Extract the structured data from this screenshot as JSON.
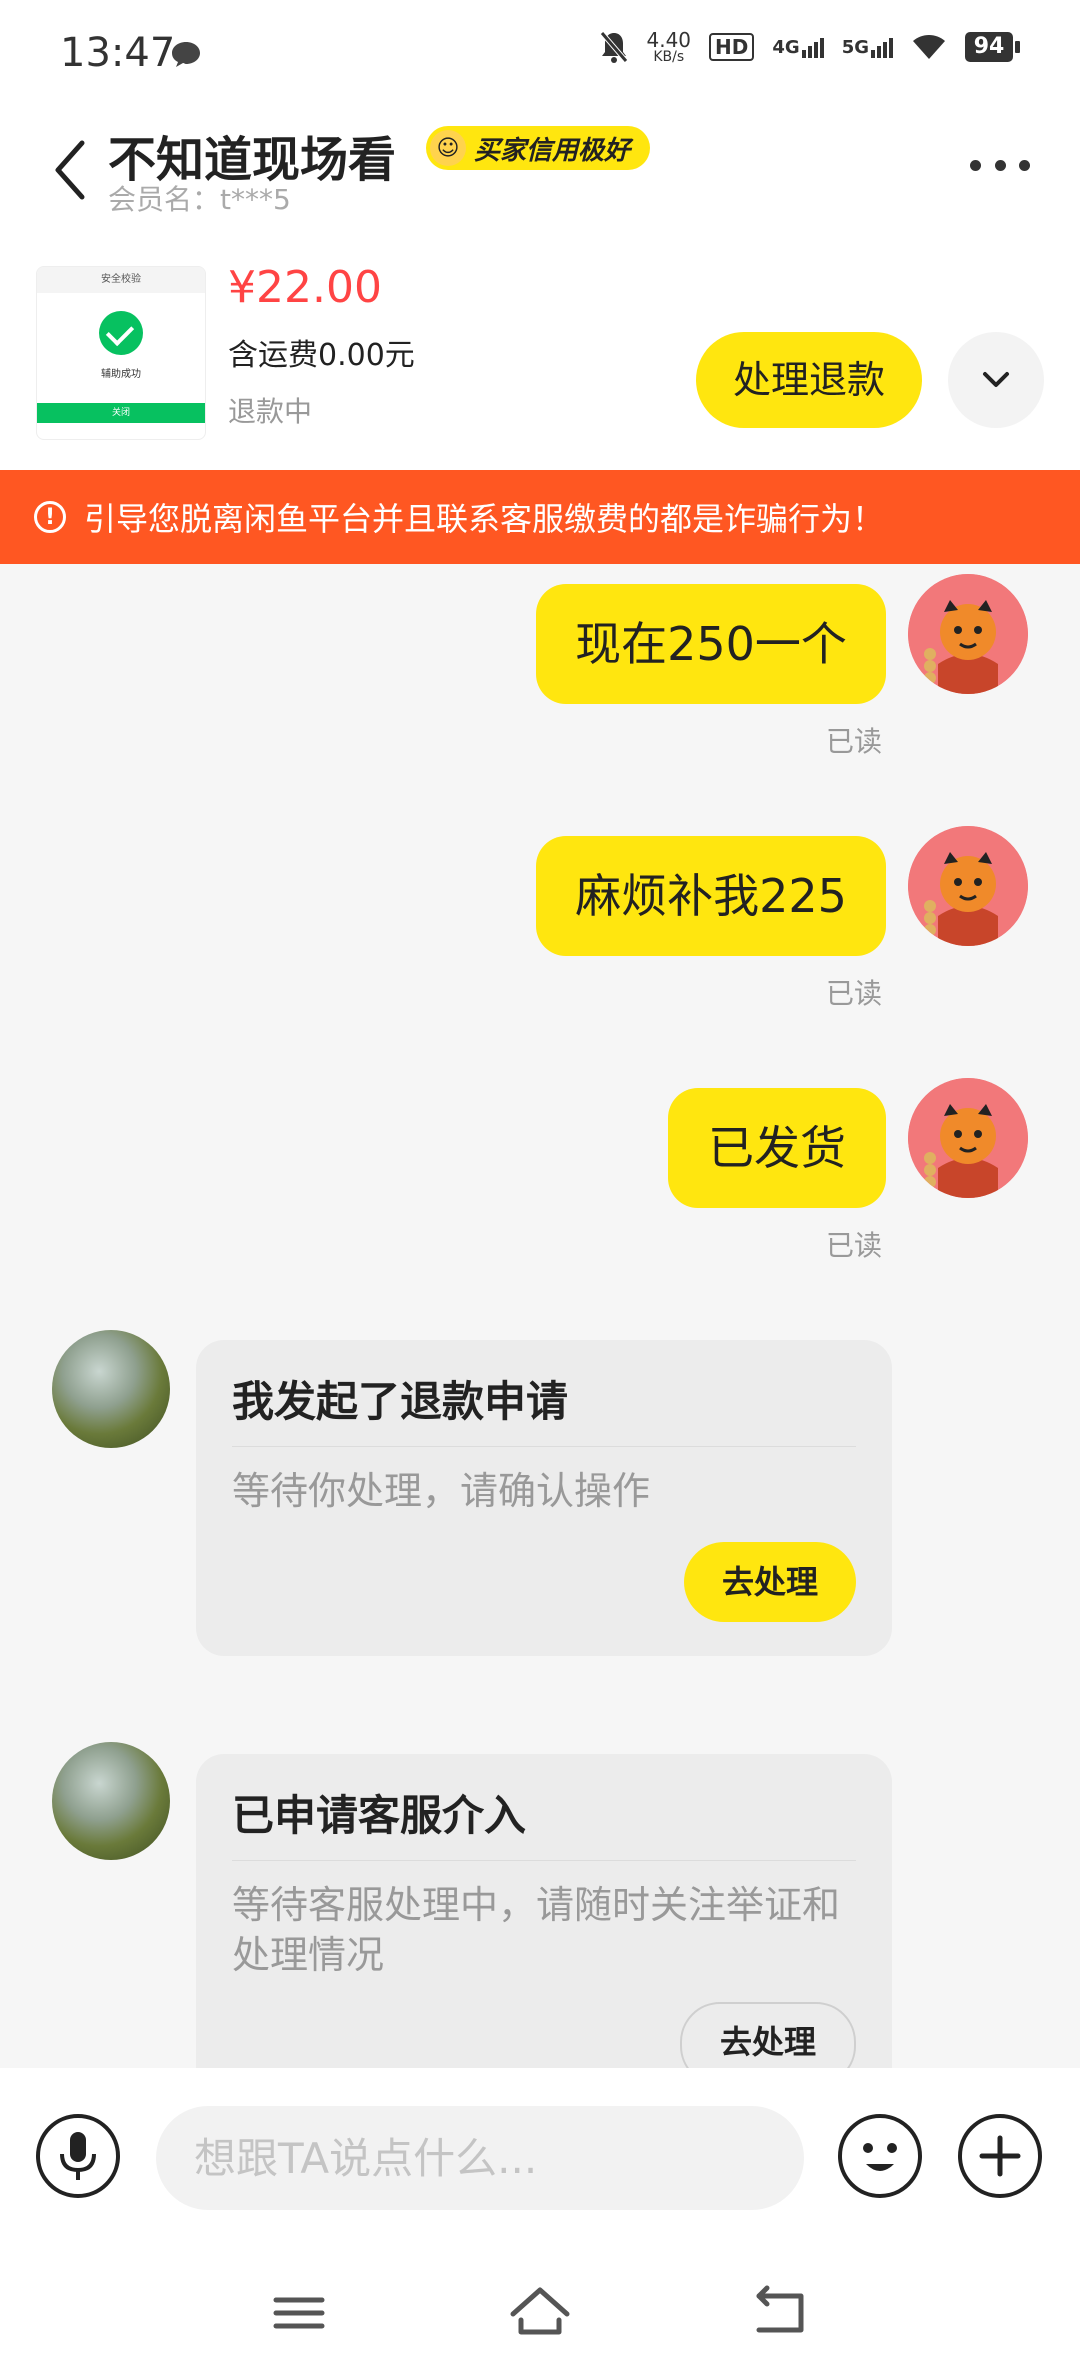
{
  "status_bar": {
    "time": "13:47",
    "net_speed_value": "4.40",
    "net_speed_unit": "KB/s",
    "hd_label": "HD",
    "sim1_label": "4G",
    "sim2_label": "5G",
    "battery": "94"
  },
  "header": {
    "title": "不知道现场看",
    "credit_badge": "买家信用极好",
    "member_name": "会员名：t***5"
  },
  "order": {
    "thumb_head": "安全校验",
    "thumb_text": "辅助成功",
    "thumb_bar": "关闭",
    "price": "¥22.00",
    "shipping": "含运费0.00元",
    "status": "退款中",
    "refund_button": "处理退款"
  },
  "warning": {
    "text": "引导您脱离闲鱼平台并且联系客服缴费的都是诈骗行为！"
  },
  "messages": [
    {
      "text": "现在250一个",
      "read": "已读"
    },
    {
      "text": "麻烦补我225",
      "read": "已读"
    },
    {
      "text": "已发货",
      "read": "已读"
    }
  ],
  "cards": [
    {
      "title": "我发起了退款申请",
      "desc": "等待你处理，请确认操作",
      "button": "去处理"
    },
    {
      "title": "已申请客服介入",
      "desc": "等待客服处理中，请随时关注举证和处理情况",
      "button": "去处理"
    }
  ],
  "input": {
    "placeholder": "想跟TA说点什么..."
  },
  "colors": {
    "accent_yellow": "#ffe60f",
    "warning_orange": "#ff5722",
    "price_red": "#ff4444"
  }
}
